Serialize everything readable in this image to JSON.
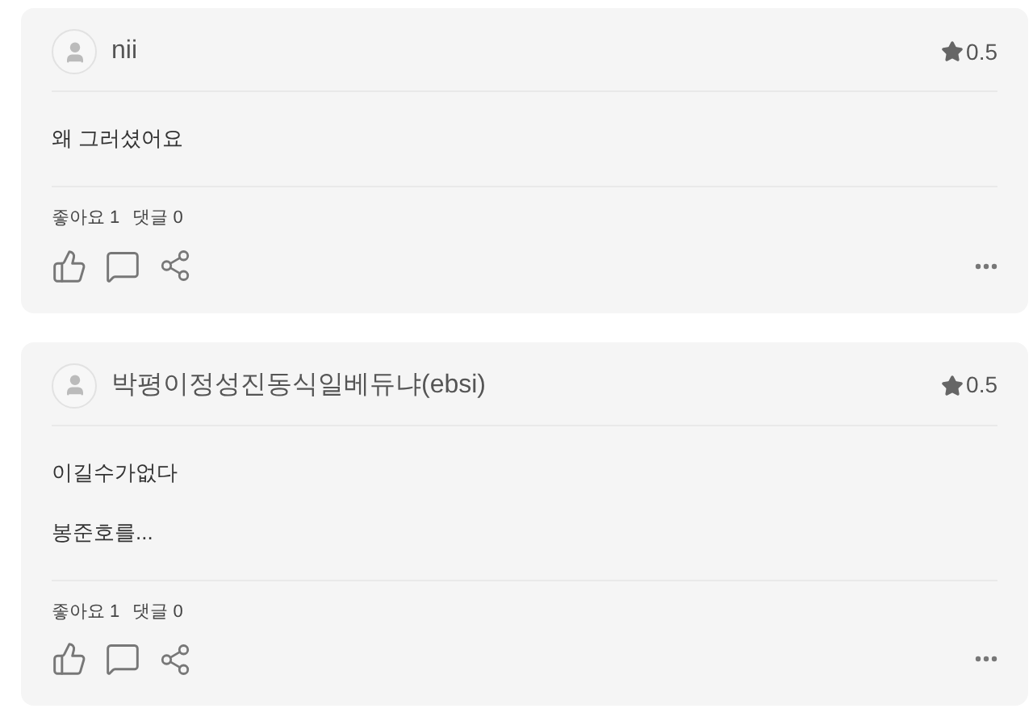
{
  "reviews": [
    {
      "author": "nii",
      "rating": "0.5",
      "paragraphs": [
        "왜 그러셨어요"
      ],
      "likes": "좋아요 1",
      "comments": "댓글 0"
    },
    {
      "author": "박평이정성진동식일베듀냐(ebsi)",
      "rating": "0.5",
      "paragraphs": [
        "이길수가없다",
        "봉준호를..."
      ],
      "likes": "좋아요 1",
      "comments": "댓글 0"
    }
  ]
}
